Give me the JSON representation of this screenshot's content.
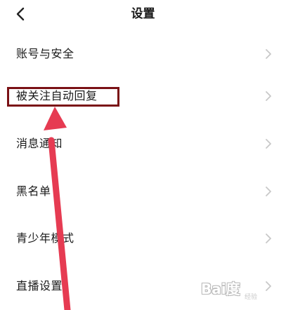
{
  "header": {
    "title": "设置",
    "back_icon": "chevron-left-icon"
  },
  "settings": {
    "items": [
      {
        "label": "账号与安全"
      },
      {
        "label": "被关注自动回复"
      },
      {
        "label": "消息通知"
      },
      {
        "label": "黑名单"
      },
      {
        "label": "青少年模式"
      },
      {
        "label": "直播设置"
      }
    ],
    "chevron_icon": "chevron-right-icon"
  },
  "annotation": {
    "highlight_color": "#7a1115",
    "arrow_color": "#e63b52"
  },
  "watermark": {
    "text": "Bai度",
    "subtext": "经验"
  }
}
